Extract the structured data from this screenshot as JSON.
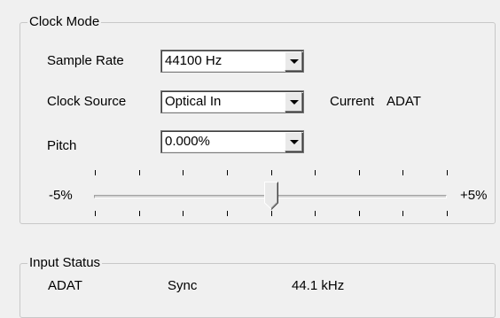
{
  "clock_mode": {
    "title": "Clock Mode",
    "sample_rate": {
      "label": "Sample Rate",
      "value": "44100 Hz",
      "dropdown_icon": "chevron-down-icon"
    },
    "clock_source": {
      "label": "Clock Source",
      "value": "Optical In",
      "current_label": "Current",
      "current_value": "ADAT",
      "dropdown_icon": "chevron-down-icon"
    },
    "pitch": {
      "label": "Pitch",
      "value": "0.000%",
      "dropdown_icon": "chevron-down-icon"
    },
    "pitch_slider": {
      "min_label": "-5%",
      "max_label": "+5%",
      "min": -5,
      "max": 5,
      "value": 0,
      "tick_count": 9
    }
  },
  "input_status": {
    "title": "Input Status",
    "rows": [
      {
        "input": "ADAT",
        "state": "Sync",
        "rate": "44.1 kHz"
      }
    ]
  }
}
